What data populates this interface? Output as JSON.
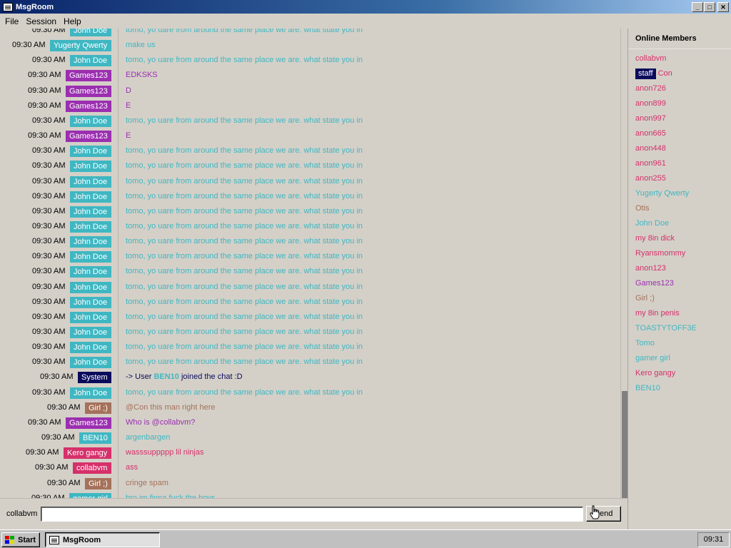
{
  "window": {
    "title": "MsgRoom"
  },
  "menu": [
    "File",
    "Session",
    "Help"
  ],
  "colors": {
    "john": "#3fb7c2",
    "yugerty": "#3fb7c2",
    "games": "#9b2fb0",
    "system": "#0b0b5c",
    "girl": "#a5715a",
    "ben10": "#3fb7c2",
    "kero": "#d6306a",
    "collabvm": "#d6306a",
    "gamergirl": "#3fb7c2"
  },
  "messages": [
    {
      "time": "09:30 AM",
      "user": "John Doe",
      "color": "#3fb7c2",
      "text": "tomo, yo uare from around the same place we are. what state you in",
      "text_color": "#3fb7c2"
    },
    {
      "time": "09:30 AM",
      "user": "Yugerty Qwerty",
      "color": "#3fb7c2",
      "text": "make us",
      "text_color": "#3fb7c2"
    },
    {
      "time": "09:30 AM",
      "user": "John Doe",
      "color": "#3fb7c2",
      "text": "tomo, yo uare from around the same place we are. what state you in",
      "text_color": "#3fb7c2"
    },
    {
      "time": "09:30 AM",
      "user": "Games123",
      "color": "#9b2fb0",
      "text": "EDKSKS",
      "text_color": "#9b2fb0"
    },
    {
      "time": "09:30 AM",
      "user": "Games123",
      "color": "#9b2fb0",
      "text": "D",
      "text_color": "#9b2fb0"
    },
    {
      "time": "09:30 AM",
      "user": "Games123",
      "color": "#9b2fb0",
      "text": "E",
      "text_color": "#9b2fb0"
    },
    {
      "time": "09:30 AM",
      "user": "John Doe",
      "color": "#3fb7c2",
      "text": "tomo, yo uare from around the same place we are. what state you in",
      "text_color": "#3fb7c2"
    },
    {
      "time": "09:30 AM",
      "user": "Games123",
      "color": "#9b2fb0",
      "text": "E",
      "text_color": "#9b2fb0"
    },
    {
      "time": "09:30 AM",
      "user": "John Doe",
      "color": "#3fb7c2",
      "text": "tomo, yo uare from around the same place we are. what state you in",
      "text_color": "#3fb7c2"
    },
    {
      "time": "09:30 AM",
      "user": "John Doe",
      "color": "#3fb7c2",
      "text": "tomo, yo uare from around the same place we are. what state you in",
      "text_color": "#3fb7c2"
    },
    {
      "time": "09:30 AM",
      "user": "John Doe",
      "color": "#3fb7c2",
      "text": "tomo, yo uare from around the same place we are. what state you in",
      "text_color": "#3fb7c2"
    },
    {
      "time": "09:30 AM",
      "user": "John Doe",
      "color": "#3fb7c2",
      "text": "tomo, yo uare from around the same place we are. what state you in",
      "text_color": "#3fb7c2"
    },
    {
      "time": "09:30 AM",
      "user": "John Doe",
      "color": "#3fb7c2",
      "text": "tomo, yo uare from around the same place we are. what state you in",
      "text_color": "#3fb7c2"
    },
    {
      "time": "09:30 AM",
      "user": "John Doe",
      "color": "#3fb7c2",
      "text": "tomo, yo uare from around the same place we are. what state you in",
      "text_color": "#3fb7c2"
    },
    {
      "time": "09:30 AM",
      "user": "John Doe",
      "color": "#3fb7c2",
      "text": "tomo, yo uare from around the same place we are. what state you in",
      "text_color": "#3fb7c2"
    },
    {
      "time": "09:30 AM",
      "user": "John Doe",
      "color": "#3fb7c2",
      "text": "tomo, yo uare from around the same place we are. what state you in",
      "text_color": "#3fb7c2"
    },
    {
      "time": "09:30 AM",
      "user": "John Doe",
      "color": "#3fb7c2",
      "text": "tomo, yo uare from around the same place we are. what state you in",
      "text_color": "#3fb7c2"
    },
    {
      "time": "09:30 AM",
      "user": "John Doe",
      "color": "#3fb7c2",
      "text": "tomo, yo uare from around the same place we are. what state you in",
      "text_color": "#3fb7c2"
    },
    {
      "time": "09:30 AM",
      "user": "John Doe",
      "color": "#3fb7c2",
      "text": "tomo, yo uare from around the same place we are. what state you in",
      "text_color": "#3fb7c2"
    },
    {
      "time": "09:30 AM",
      "user": "John Doe",
      "color": "#3fb7c2",
      "text": "tomo, yo uare from around the same place we are. what state you in",
      "text_color": "#3fb7c2"
    },
    {
      "time": "09:30 AM",
      "user": "John Doe",
      "color": "#3fb7c2",
      "text": "tomo, yo uare from around the same place we are. what state you in",
      "text_color": "#3fb7c2"
    },
    {
      "time": "09:30 AM",
      "user": "John Doe",
      "color": "#3fb7c2",
      "text": "tomo, yo uare from around the same place we are. what state you in",
      "text_color": "#3fb7c2"
    },
    {
      "time": "09:30 AM",
      "user": "John Doe",
      "color": "#3fb7c2",
      "text": "tomo, yo uare from around the same place we are. what state you in",
      "text_color": "#3fb7c2"
    },
    {
      "time": "09:30 AM",
      "user": "System",
      "color": "#0b0b5c",
      "system": true,
      "text_prefix": "-> User ",
      "text_bold": "BEN10",
      "text_suffix": " joined the chat :D",
      "text_color": "#0b0b5c",
      "bold_color": "#3fb7c2"
    },
    {
      "time": "09:30 AM",
      "user": "John Doe",
      "color": "#3fb7c2",
      "text": "tomo, yo uare from around the same place we are. what state you in",
      "text_color": "#3fb7c2"
    },
    {
      "time": "09:30 AM",
      "user": "Girl ;)",
      "color": "#a5715a",
      "text": "@Con this man right here",
      "text_color": "#a5715a"
    },
    {
      "time": "09:30 AM",
      "user": "Games123",
      "color": "#9b2fb0",
      "text": "Who is @collabvm?",
      "text_color": "#9b2fb0"
    },
    {
      "time": "09:30 AM",
      "user": "BEN10",
      "color": "#3fb7c2",
      "text": "argenbargen",
      "text_color": "#3fb7c2"
    },
    {
      "time": "09:30 AM",
      "user": "Kero gangy",
      "color": "#d6306a",
      "text": "wasssuppppp lil ninjas",
      "text_color": "#d6306a"
    },
    {
      "time": "09:30 AM",
      "user": "collabvm",
      "color": "#d6306a",
      "text": "ass",
      "text_color": "#d6306a"
    },
    {
      "time": "09:30 AM",
      "user": "Girl ;)",
      "color": "#a5715a",
      "text": "cringe spam",
      "text_color": "#a5715a"
    },
    {
      "time": "09:30 AM",
      "user": "gamer girl",
      "color": "#3fb7c2",
      "text": "bro im finna fuck the boys",
      "text_color": "#3fb7c2"
    }
  ],
  "members": {
    "heading": "Online Members",
    "list": [
      {
        "name": "collabvm",
        "color": "#d6306a"
      },
      {
        "name": "Con",
        "color": "#d6306a",
        "badge": "staff"
      },
      {
        "name": "anon726",
        "color": "#d6306a"
      },
      {
        "name": "anon899",
        "color": "#d6306a"
      },
      {
        "name": "anon997",
        "color": "#d6306a"
      },
      {
        "name": "anon665",
        "color": "#d6306a"
      },
      {
        "name": "anon448",
        "color": "#d6306a"
      },
      {
        "name": "anon961",
        "color": "#d6306a"
      },
      {
        "name": "anon255",
        "color": "#d6306a"
      },
      {
        "name": "Yugerty Qwerty",
        "color": "#3fb7c2"
      },
      {
        "name": "Otis",
        "color": "#a5715a"
      },
      {
        "name": "John Doe",
        "color": "#3fb7c2"
      },
      {
        "name": "my 8in dick",
        "color": "#d6306a"
      },
      {
        "name": "Ryansmommy",
        "color": "#d6306a"
      },
      {
        "name": "anon123",
        "color": "#d6306a"
      },
      {
        "name": "Games123",
        "color": "#9b2fb0"
      },
      {
        "name": "Girl ;)",
        "color": "#a5715a"
      },
      {
        "name": "my 8in penis",
        "color": "#d6306a"
      },
      {
        "name": "TOASTYTOFF3E",
        "color": "#3fb7c2"
      },
      {
        "name": "Tomo",
        "color": "#3fb7c2"
      },
      {
        "name": "gamer girl",
        "color": "#3fb7c2"
      },
      {
        "name": "Kero gangy",
        "color": "#d6306a"
      },
      {
        "name": "BEN10",
        "color": "#3fb7c2"
      }
    ]
  },
  "input": {
    "username": "collabvm",
    "value": "",
    "send_label": "Send"
  },
  "taskbar": {
    "start_label": "Start",
    "task_label": "MsgRoom",
    "clock": "09:31"
  }
}
